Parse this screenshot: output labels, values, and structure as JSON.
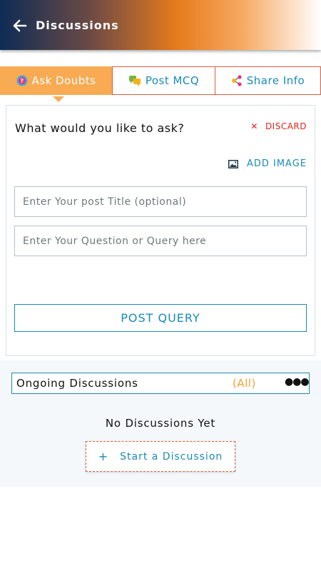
{
  "header": {
    "title": "Discussions"
  },
  "tabs": [
    {
      "label": "Ask Doubts",
      "active": true
    },
    {
      "label": "Post MCQ",
      "active": false
    },
    {
      "label": "Share Info",
      "active": false
    }
  ],
  "ask_card": {
    "heading": "What would you like to ask?",
    "discard_label": "DISCARD",
    "add_image_label": "ADD IMAGE",
    "title_placeholder": "Enter Your post Title (optional)",
    "title_value": "",
    "question_placeholder": "Enter Your Question or Query here",
    "question_value": "",
    "post_button_label": "POST QUERY"
  },
  "ongoing": {
    "label": "Ongoing Discussions",
    "filter_label": "(All)",
    "empty_text": "No Discussions Yet",
    "start_button_label": "Start a Discussion"
  },
  "colors": {
    "accent_orange": "#f8ab52",
    "link_blue": "#1a8ab5",
    "discard_red": "#e2231a",
    "header_gradient_start": "#0d2b55",
    "header_gradient_mid": "#e67a1c"
  },
  "icons": {
    "back": "arrow-left-icon",
    "ask_doubts": "question-bubble-icon",
    "post_mcq": "chat-bubbles-icon",
    "share_info": "share-icon",
    "add_image": "image-icon",
    "more": "more-horizontal-icon",
    "discard": "close-icon",
    "start": "plus-icon"
  }
}
